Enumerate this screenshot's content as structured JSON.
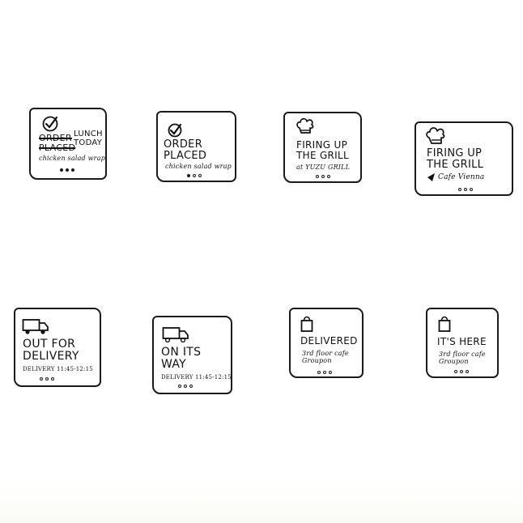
{
  "cards": [
    {
      "id": "order-lunch",
      "icon": "checkmark-icon",
      "head_strike": [
        "ORDER",
        "PLACED"
      ],
      "head_right": [
        "LUNCH",
        "TODAY"
      ],
      "sub": "chicken salad wrap"
    },
    {
      "id": "order-placed",
      "icon": "checkmark-icon",
      "head": [
        "ORDER",
        "PLACED"
      ],
      "sub": "chicken salad wrap"
    },
    {
      "id": "firing-yuzu",
      "icon": "chef-hat-icon",
      "head": [
        "FIRING UP",
        "THE GRILL"
      ],
      "sub": "at YUZU GRILL"
    },
    {
      "id": "firing-vienna",
      "icon": "chef-hat-icon",
      "head": [
        "FIRING UP",
        "THE GRILL"
      ],
      "sub": "Cafe Vienna",
      "sub_icon": "location-pin-icon"
    },
    {
      "id": "out-for-delivery",
      "icon": "truck-icon",
      "head": [
        "OUT FOR",
        "DELIVERY"
      ],
      "sub": "DELIVERY 11:45-12:15"
    },
    {
      "id": "on-its-way",
      "icon": "truck-icon",
      "head": [
        "ON ITS",
        "WAY"
      ],
      "sub": "DELIVERY 11:45-12:15"
    },
    {
      "id": "delivered",
      "icon": "bag-icon",
      "head": [
        "DELIVERED"
      ],
      "sub_lines": [
        "3rd floor cafe",
        "Groupon"
      ]
    },
    {
      "id": "its-here",
      "icon": "bag-icon",
      "head": [
        "IT'S HERE"
      ],
      "sub_lines": [
        "3rd floor cafe",
        "Groupon"
      ]
    }
  ]
}
